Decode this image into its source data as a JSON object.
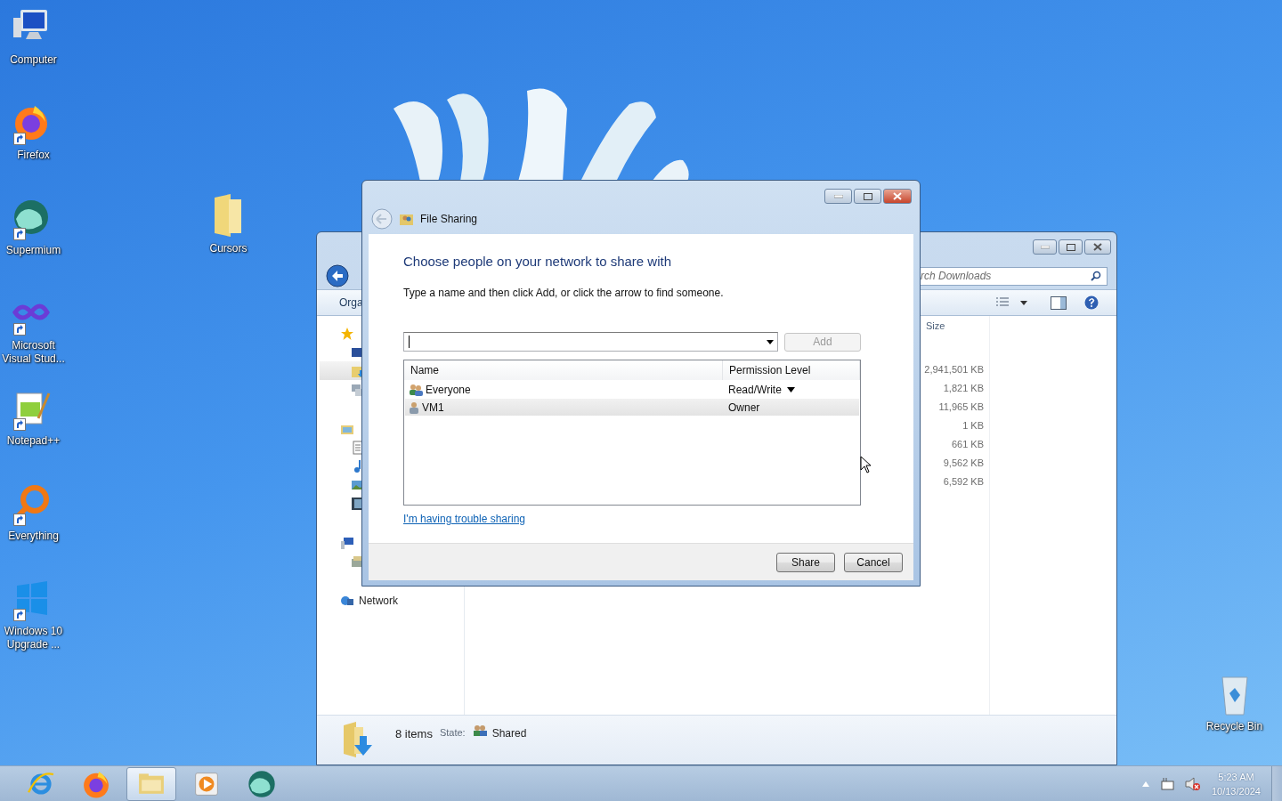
{
  "desktop_icons": [
    {
      "label": "Computer",
      "kind": "computer",
      "shortcut": false
    },
    {
      "label": "Firefox",
      "kind": "firefox",
      "shortcut": true
    },
    {
      "label": "Supermium",
      "kind": "supermium",
      "shortcut": true
    },
    {
      "label": "Microsoft Visual Stud...",
      "kind": "visualstudio",
      "shortcut": true
    },
    {
      "label": "Notepad++",
      "kind": "notepad",
      "shortcut": true
    },
    {
      "label": "Everything",
      "kind": "everything",
      "shortcut": true
    },
    {
      "label": "Windows 10 Upgrade ...",
      "kind": "windows",
      "shortcut": true
    }
  ],
  "folder_icon": {
    "label": "Cursors"
  },
  "recycle_bin": {
    "label": "Recycle Bin"
  },
  "explorer": {
    "search": {
      "placeholder": "rch Downloads"
    },
    "toolbar": {
      "organize": "Orga"
    },
    "nav": [
      {
        "kind": "favorites",
        "selected": false
      },
      {
        "kind": "desktop",
        "selected": false
      },
      {
        "kind": "downloads",
        "selected": true
      },
      {
        "kind": "recent",
        "selected": false
      },
      {
        "kind": "libraries",
        "selected": false
      },
      {
        "kind": "documents",
        "selected": false
      },
      {
        "kind": "music",
        "selected": false
      },
      {
        "kind": "pictures",
        "selected": false
      },
      {
        "kind": "videos",
        "selected": false
      },
      {
        "kind": "computer",
        "selected": false
      },
      {
        "kind": "drive",
        "selected": false
      },
      {
        "kind": "network",
        "label": "Network",
        "selected": false
      }
    ],
    "size_column": {
      "header": "Size",
      "values": [
        "2,941,501 KB",
        "1,821 KB",
        "11,965 KB",
        "1 KB",
        "661 KB",
        "9,562 KB",
        "6,592 KB"
      ]
    },
    "status_bar": {
      "count": "8 items",
      "state_label": "State:",
      "state": "Shared"
    }
  },
  "dialog": {
    "title": "File Sharing",
    "heading": "Choose people on your network to share with",
    "instruction": "Type a name and then click Add, or click the arrow to find someone.",
    "add_button": {
      "label": "Add",
      "disabled": true
    },
    "table": {
      "columns": [
        "Name",
        "Permission Level"
      ],
      "rows": [
        {
          "name": "Everyone",
          "kind": "group",
          "permission": "Read/Write",
          "has_menu": true,
          "selected": false
        },
        {
          "name": "VM1",
          "kind": "user",
          "permission": "Owner",
          "has_menu": false,
          "selected": true
        }
      ]
    },
    "help_link": "I'm having trouble sharing",
    "buttons": [
      "Share",
      "Cancel"
    ]
  },
  "taskbar": {
    "apps": [
      {
        "kind": "ie",
        "active": false
      },
      {
        "kind": "firefox",
        "active": false
      },
      {
        "kind": "explorer",
        "active": true
      },
      {
        "kind": "media",
        "active": false
      },
      {
        "kind": "supermium",
        "active": false
      }
    ],
    "clock": {
      "time": "5:23 AM",
      "date": "10/13/2024"
    }
  }
}
